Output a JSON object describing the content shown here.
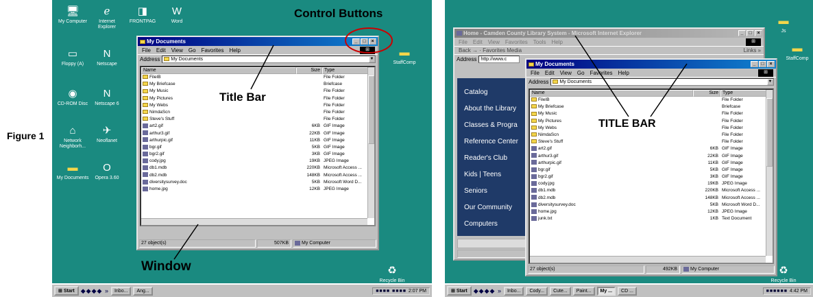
{
  "figure_label": "Figure 1",
  "desktop_icons_left": [
    {
      "label": "My Computer",
      "icon": "computer-icon"
    },
    {
      "label": "Internet Explorer",
      "icon": "ie-icon"
    },
    {
      "label": "FRONTPAG",
      "icon": "frontpage-icon"
    },
    {
      "label": "Word",
      "icon": "word-icon"
    },
    {
      "label": "Floppy (A)",
      "icon": "floppy-icon"
    },
    {
      "label": "Netscape",
      "icon": "netscape-icon"
    },
    {
      "label": "CD-ROM Disc",
      "icon": "cdrom-icon"
    },
    {
      "label": "Netscape 6",
      "icon": "netscape-icon"
    },
    {
      "label": "Network Neighborh...",
      "icon": "network-icon"
    },
    {
      "label": "Neoflanet",
      "icon": "neoplanet-icon"
    },
    {
      "label": "My Documents",
      "icon": "folder-icon"
    },
    {
      "label": "Opera 3.60",
      "icon": "opera-icon"
    },
    {
      "label": "StaffComp",
      "icon": "folder-icon"
    },
    {
      "label": "Recycle Bin",
      "icon": "recycle-bin-icon"
    }
  ],
  "desktop_icons_right": [
    {
      "label": "Js",
      "icon": "folder-icon"
    },
    {
      "label": "StaffComp",
      "icon": "folder-icon"
    },
    {
      "label": "Recycle Bin",
      "icon": "recycle-bin-icon"
    }
  ],
  "explorer_window": {
    "title": "My Documents",
    "menu": [
      "File",
      "Edit",
      "View",
      "Go",
      "Favorites",
      "Help"
    ],
    "address_label": "Address",
    "address_value": "My Documents",
    "columns": [
      "Name",
      "Size",
      "Type"
    ],
    "files": [
      {
        "name": "FileIB",
        "size": "",
        "type": "File Folder",
        "kind": "folder"
      },
      {
        "name": "My Briefcase",
        "size": "",
        "type": "Briefcase",
        "kind": "folder"
      },
      {
        "name": "My Music",
        "size": "",
        "type": "File Folder",
        "kind": "folder"
      },
      {
        "name": "My Pictures",
        "size": "",
        "type": "File Folder",
        "kind": "folder"
      },
      {
        "name": "My Webs",
        "size": "",
        "type": "File Folder",
        "kind": "folder"
      },
      {
        "name": "NimdaScn",
        "size": "",
        "type": "File Folder",
        "kind": "folder"
      },
      {
        "name": "Steve's Stuff",
        "size": "",
        "type": "File Folder",
        "kind": "folder"
      },
      {
        "name": "art2.gif",
        "size": "6KB",
        "type": "GIF Image",
        "kind": "file"
      },
      {
        "name": "arthur3.gif",
        "size": "22KB",
        "type": "GIF Image",
        "kind": "file"
      },
      {
        "name": "arthurpic.gif",
        "size": "11KB",
        "type": "GIF Image",
        "kind": "file"
      },
      {
        "name": "bgr.gif",
        "size": "5KB",
        "type": "GIF Image",
        "kind": "file"
      },
      {
        "name": "bgr2.gif",
        "size": "3KB",
        "type": "GIF Image",
        "kind": "file"
      },
      {
        "name": "cody.jpg",
        "size": "19KB",
        "type": "JPEG Image",
        "kind": "file"
      },
      {
        "name": "db1.mdb",
        "size": "220KB",
        "type": "Microsoft Access ...",
        "kind": "file"
      },
      {
        "name": "db2.mdb",
        "size": "148KB",
        "type": "Microsoft Access ...",
        "kind": "file"
      },
      {
        "name": "diversitysurvey.doc",
        "size": "5KB",
        "type": "Microsoft Word D...",
        "kind": "file"
      },
      {
        "name": "home.jpg",
        "size": "12KB",
        "type": "JPEG Image",
        "kind": "file"
      },
      {
        "name": "junk.txt",
        "size": "1KB",
        "type": "Text Document",
        "kind": "file"
      }
    ],
    "status_count": "27 object(s)",
    "status_size_left": "507KB",
    "status_size_right": "492KB",
    "status_location": "My Computer"
  },
  "ie_window": {
    "title": "Home - Camden County Library System - Microsoft Internet Explorer",
    "menu": [
      "File",
      "Edit",
      "View",
      "Favorites",
      "Tools",
      "Help"
    ],
    "toolbar": "Back  →  ·  Favorites  Media",
    "links": "Links »",
    "address_label": "Address",
    "address_value": "http://www.c",
    "sidebar": [
      "Catalog",
      "About the Library",
      "Classes & Progra",
      "Reference Center",
      "Reader's Club",
      "Kids  |  Teens",
      "Seniors",
      "Our Community",
      "Computers"
    ]
  },
  "annotations": {
    "control_buttons": "Control Buttons",
    "title_bar": "Title Bar",
    "window": "Window",
    "title_bar_caps": "TITLE BAR"
  },
  "taskbar_left": {
    "start": "Start",
    "quicklaunch": "» ",
    "buttons": [
      "Inbo...",
      "Ang..."
    ],
    "clock": "2:07 PM"
  },
  "taskbar_right": {
    "start": "Start",
    "buttons": [
      "Inbo...",
      "Cody...",
      "Cute...",
      "Paint...",
      "My ...",
      "CD ..."
    ],
    "clock": "4:42 PM"
  },
  "colors": {
    "desktop": "#1a8a80",
    "titlebar_active": "#000080",
    "annotation_circle": "#cc0000"
  }
}
